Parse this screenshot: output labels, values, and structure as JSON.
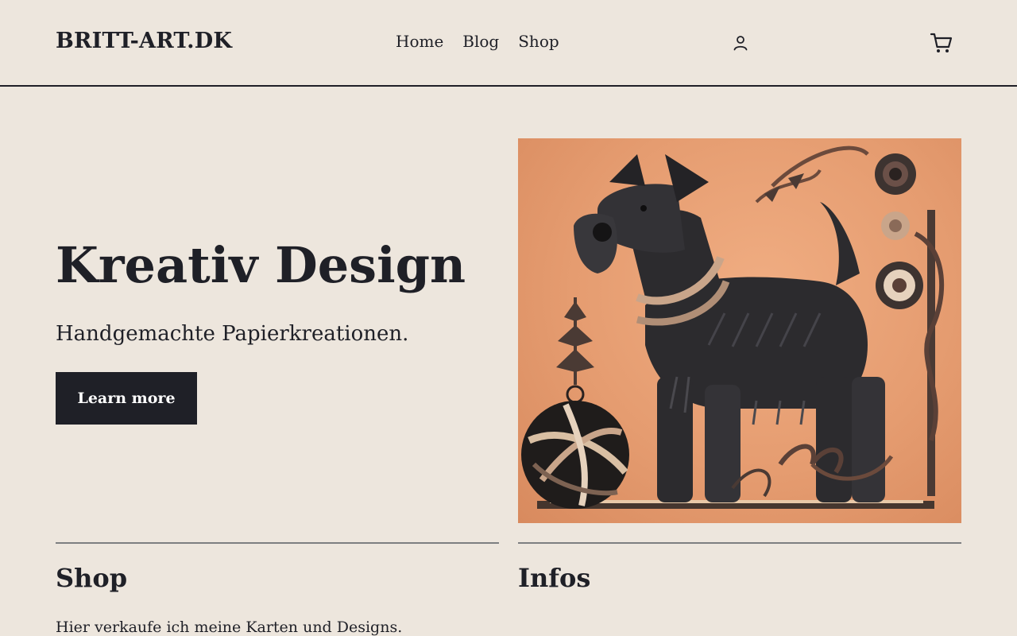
{
  "header": {
    "brand": "BRITT-ART.DK",
    "nav": [
      {
        "label": "Home"
      },
      {
        "label": "Blog"
      },
      {
        "label": "Shop"
      }
    ],
    "icons": {
      "account": "user-icon",
      "cart": "cart-icon"
    }
  },
  "hero": {
    "title": "Kreativ Design",
    "subtitle": "Handgemachte Papierkreationen.",
    "cta_label": "Learn more",
    "image_alt": ""
  },
  "sections": {
    "shop": {
      "title": "Shop",
      "text": "Hier verkaufe ich meine Karten und Designs."
    },
    "infos": {
      "title": "Infos"
    }
  },
  "colors": {
    "background": "#ede6dd",
    "text": "#1f2027",
    "button": "#1f2027",
    "image_background": "#e59c70"
  }
}
